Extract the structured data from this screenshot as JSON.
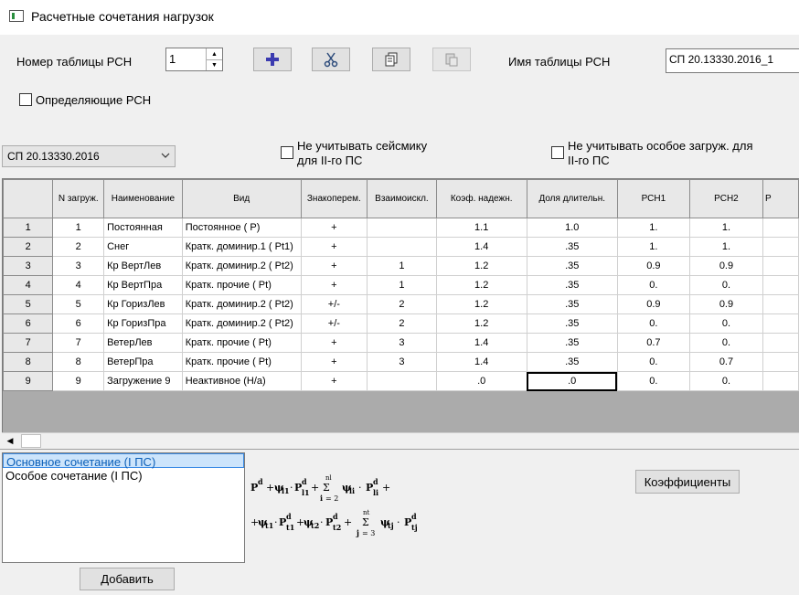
{
  "window": {
    "title": "Расчетные сочетания нагрузок"
  },
  "top": {
    "table_number_label": "Номер таблицы РСН",
    "table_number_value": "1",
    "table_name_label": "Имя таблицы РСН",
    "table_name_value": "СП 20.13330.2016_1",
    "defining_label": "Определяющие РСН",
    "norm_select_value": "СП 20.13330.2016",
    "ignore_seismic_label_1": "Не учитывать сейсмику",
    "ignore_seismic_label_2": "для II-го ПС",
    "ignore_special_label_1": "Не учитывать особое загруж. для",
    "ignore_special_label_2": "II-го ПС"
  },
  "toolbar": {
    "add_icon": "plus-icon",
    "cut_icon": "scissors-icon",
    "copy_icon": "copy-icon",
    "paste_icon": "paste-icon"
  },
  "grid": {
    "columns": [
      "N загруж.",
      "Наименование",
      "Вид",
      "Знакоперем.",
      "Взаимоискл.",
      "Коэф. надежн.",
      "Доля длительн.",
      "РСН1",
      "РСН2",
      "Р"
    ],
    "rows": [
      {
        "rn": "1",
        "n": "1",
        "name": "Постоянная",
        "kind": "Постоянное ( P)",
        "sign": "+",
        "excl": "",
        "coef": "1.1",
        "dur": "1.0",
        "r1": "1.",
        "r2": "1."
      },
      {
        "rn": "2",
        "n": "2",
        "name": "Снег",
        "kind": "Кратк. доминир.1 ( Pt1)",
        "sign": "+",
        "excl": "",
        "coef": "1.4",
        "dur": ".35",
        "r1": "1.",
        "r2": "1."
      },
      {
        "rn": "3",
        "n": "3",
        "name": "Кр ВертЛев",
        "kind": "Кратк. доминир.2 ( Pt2)",
        "sign": "+",
        "excl": "1",
        "coef": "1.2",
        "dur": ".35",
        "r1": "0.9",
        "r2": "0.9"
      },
      {
        "rn": "4",
        "n": "4",
        "name": "Кр ВертПра",
        "kind": "Кратк. прочие ( Pt)",
        "sign": "+",
        "excl": "1",
        "coef": "1.2",
        "dur": ".35",
        "r1": "0.",
        "r2": "0."
      },
      {
        "rn": "5",
        "n": "5",
        "name": "Кр ГоризЛев",
        "kind": "Кратк. доминир.2 ( Pt2)",
        "sign": "+/-",
        "excl": "2",
        "coef": "1.2",
        "dur": ".35",
        "r1": "0.9",
        "r2": "0.9"
      },
      {
        "rn": "6",
        "n": "6",
        "name": "Кр ГоризПра",
        "kind": "Кратк. доминир.2 ( Pt2)",
        "sign": "+/-",
        "excl": "2",
        "coef": "1.2",
        "dur": ".35",
        "r1": "0.",
        "r2": "0."
      },
      {
        "rn": "7",
        "n": "7",
        "name": "ВетерЛев",
        "kind": "Кратк. прочие ( Pt)",
        "sign": "+",
        "excl": "3",
        "coef": "1.4",
        "dur": ".35",
        "r1": "0.7",
        "r2": "0."
      },
      {
        "rn": "8",
        "n": "8",
        "name": "ВетерПра",
        "kind": "Кратк. прочие ( Pt)",
        "sign": "+",
        "excl": "3",
        "coef": "1.4",
        "dur": ".35",
        "r1": "0.",
        "r2": "0.7"
      },
      {
        "rn": "9",
        "n": "9",
        "name": "Загружение 9",
        "kind": "Неактивное (Н/а)",
        "sign": "+",
        "excl": "",
        "coef": ".0",
        "dur": ".0",
        "r1": "0.",
        "r2": "0."
      }
    ]
  },
  "bottom": {
    "combos": [
      "Основное сочетание (I ПС)",
      "Особое сочетание (I ПС)"
    ],
    "add_label": "Добавить",
    "coeffs_label": "Коэффициенты"
  }
}
